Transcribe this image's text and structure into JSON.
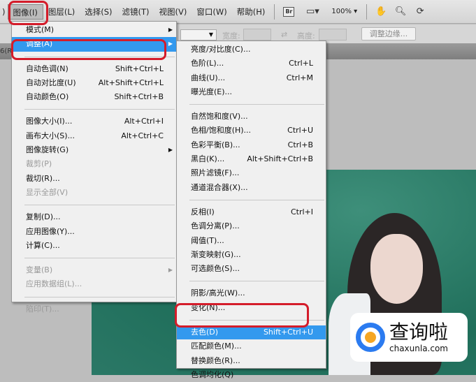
{
  "menubar": {
    "items": [
      "图像(I)",
      "图层(L)",
      "选择(S)",
      "滤镜(T)",
      "视图(V)",
      "窗口(W)",
      "帮助(H)"
    ],
    "left_partial": ")",
    "bridge_label": "Br",
    "zoom": "100%"
  },
  "options_bar": {
    "width_label": "宽度:",
    "height_label": "高度:",
    "refine_edge": "调整边缘...",
    "doc_tab_partial": "6(R"
  },
  "image_menu": {
    "items": [
      {
        "label": "模式(M)",
        "shortcut": "",
        "submenu": true
      },
      {
        "label": "调整(A)",
        "shortcut": "",
        "submenu": true,
        "highlighted": true
      },
      {
        "sep": true
      },
      {
        "label": "自动色调(N)",
        "shortcut": "Shift+Ctrl+L"
      },
      {
        "label": "自动对比度(U)",
        "shortcut": "Alt+Shift+Ctrl+L"
      },
      {
        "label": "自动颜色(O)",
        "shortcut": "Shift+Ctrl+B"
      },
      {
        "sep": true
      },
      {
        "label": "图像大小(I)...",
        "shortcut": "Alt+Ctrl+I"
      },
      {
        "label": "画布大小(S)...",
        "shortcut": "Alt+Ctrl+C"
      },
      {
        "label": "图像旋转(G)",
        "shortcut": "",
        "submenu": true
      },
      {
        "label": "裁剪(P)",
        "shortcut": "",
        "disabled": true
      },
      {
        "label": "裁切(R)...",
        "shortcut": ""
      },
      {
        "label": "显示全部(V)",
        "shortcut": "",
        "disabled": true
      },
      {
        "sep": true
      },
      {
        "label": "复制(D)...",
        "shortcut": ""
      },
      {
        "label": "应用图像(Y)...",
        "shortcut": ""
      },
      {
        "label": "计算(C)...",
        "shortcut": ""
      },
      {
        "sep": true
      },
      {
        "label": "变量(B)",
        "shortcut": "",
        "submenu": true,
        "disabled": true
      },
      {
        "label": "应用数据组(L)...",
        "shortcut": "",
        "disabled": true
      },
      {
        "sep": true
      },
      {
        "label": "陷印(T)...",
        "shortcut": "",
        "disabled": true
      }
    ]
  },
  "adjust_menu": {
    "items": [
      {
        "label": "亮度/对比度(C)...",
        "shortcut": ""
      },
      {
        "label": "色阶(L)...",
        "shortcut": "Ctrl+L"
      },
      {
        "label": "曲线(U)...",
        "shortcut": "Ctrl+M"
      },
      {
        "label": "曝光度(E)...",
        "shortcut": ""
      },
      {
        "sep": true
      },
      {
        "label": "自然饱和度(V)...",
        "shortcut": ""
      },
      {
        "label": "色相/饱和度(H)...",
        "shortcut": "Ctrl+U"
      },
      {
        "label": "色彩平衡(B)...",
        "shortcut": "Ctrl+B"
      },
      {
        "label": "黑白(K)...",
        "shortcut": "Alt+Shift+Ctrl+B"
      },
      {
        "label": "照片滤镜(F)...",
        "shortcut": ""
      },
      {
        "label": "通道混合器(X)...",
        "shortcut": ""
      },
      {
        "sep": true
      },
      {
        "label": "反相(I)",
        "shortcut": "Ctrl+I"
      },
      {
        "label": "色调分离(P)...",
        "shortcut": ""
      },
      {
        "label": "阈值(T)...",
        "shortcut": ""
      },
      {
        "label": "渐变映射(G)...",
        "shortcut": ""
      },
      {
        "label": "可选颜色(S)...",
        "shortcut": ""
      },
      {
        "sep": true
      },
      {
        "label": "阴影/高光(W)...",
        "shortcut": ""
      },
      {
        "label": "变化(N)...",
        "shortcut": ""
      },
      {
        "sep": true
      },
      {
        "label": "去色(D)",
        "shortcut": "Shift+Ctrl+U",
        "highlighted": true
      },
      {
        "label": "匹配颜色(M)...",
        "shortcut": ""
      },
      {
        "label": "替换颜色(R)...",
        "shortcut": ""
      },
      {
        "label": "色调均化(Q)",
        "shortcut": ""
      }
    ]
  },
  "watermark": {
    "name": "查询啦",
    "url": "chaxunla.com"
  },
  "colors": {
    "highlight": "#3399ee",
    "annotation": "#d41c2a"
  }
}
